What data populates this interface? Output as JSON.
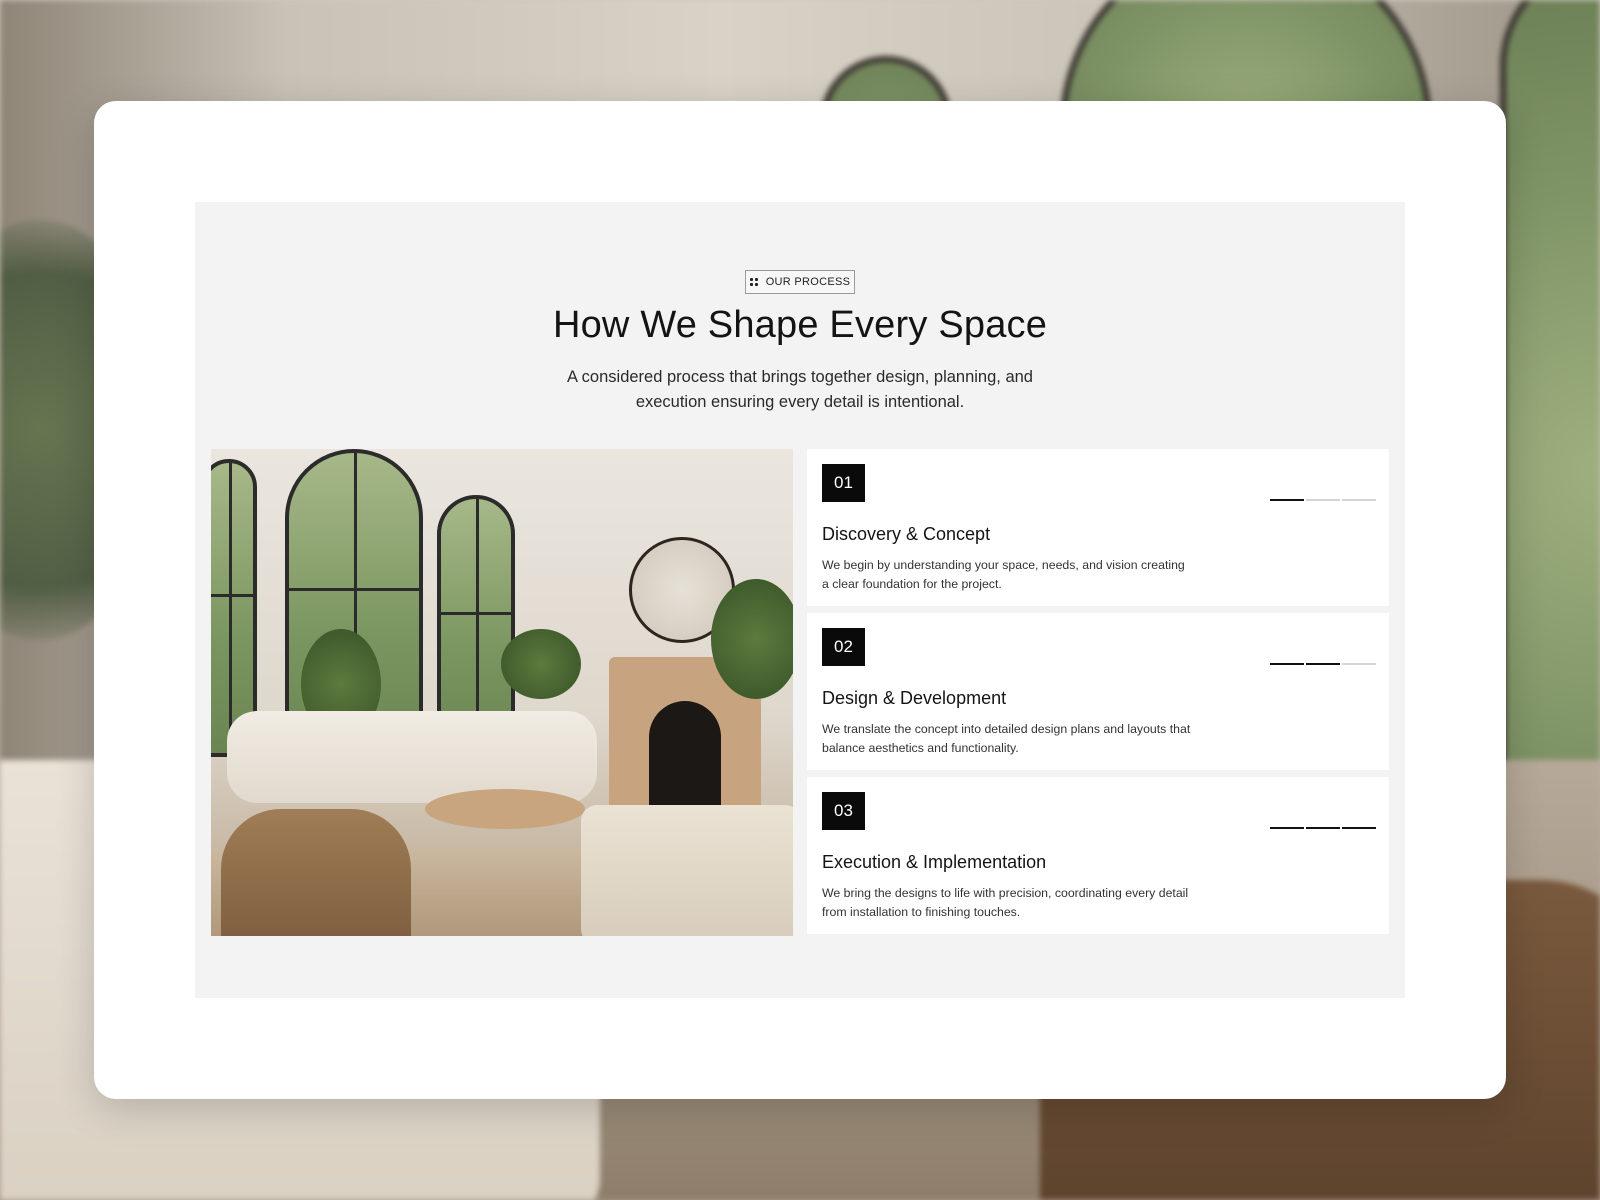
{
  "section": {
    "badge_label": "OUR PROCESS",
    "title": "How We Shape Every Space",
    "subtitle": "A considered process that brings together design, planning, and execution ensuring every detail is intentional."
  },
  "hero_image": {
    "icon": "living-room-photo"
  },
  "steps": [
    {
      "number": "01",
      "title": "Discovery & Concept",
      "description": "We begin by understanding your space, needs, and vision creating a clear foundation for the project.",
      "progress_segments_filled": 1,
      "progress_segments_total": 3
    },
    {
      "number": "02",
      "title": "Design & Development",
      "description": "We translate the concept into detailed design plans and layouts that balance aesthetics and functionality.",
      "progress_segments_filled": 2,
      "progress_segments_total": 3
    },
    {
      "number": "03",
      "title": "Execution & Implementation",
      "description": "We bring the designs to life with precision, coordinating every detail from installation to finishing touches.",
      "progress_segments_filled": 3,
      "progress_segments_total": 3
    }
  ],
  "colors": {
    "card_background": "#ffffff",
    "section_background": "#f3f3f3",
    "accent_dark": "#0a0a0a",
    "progress_inactive": "#d4d4d4"
  }
}
